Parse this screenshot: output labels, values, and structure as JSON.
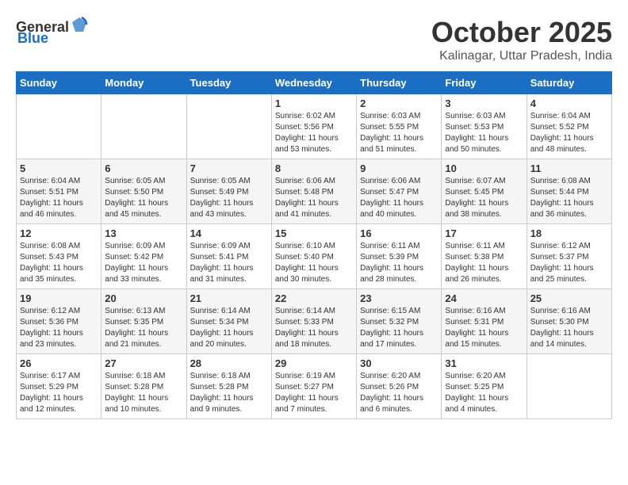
{
  "header": {
    "logo": {
      "text_general": "General",
      "text_blue": "Blue"
    },
    "month": "October 2025",
    "location": "Kalinagar, Uttar Pradesh, India"
  },
  "weekdays": [
    "Sunday",
    "Monday",
    "Tuesday",
    "Wednesday",
    "Thursday",
    "Friday",
    "Saturday"
  ],
  "weeks": [
    [
      {
        "day": "",
        "sunrise": "",
        "sunset": "",
        "daylight": ""
      },
      {
        "day": "",
        "sunrise": "",
        "sunset": "",
        "daylight": ""
      },
      {
        "day": "",
        "sunrise": "",
        "sunset": "",
        "daylight": ""
      },
      {
        "day": "1",
        "sunrise": "Sunrise: 6:02 AM",
        "sunset": "Sunset: 5:56 PM",
        "daylight": "Daylight: 11 hours and 53 minutes."
      },
      {
        "day": "2",
        "sunrise": "Sunrise: 6:03 AM",
        "sunset": "Sunset: 5:55 PM",
        "daylight": "Daylight: 11 hours and 51 minutes."
      },
      {
        "day": "3",
        "sunrise": "Sunrise: 6:03 AM",
        "sunset": "Sunset: 5:53 PM",
        "daylight": "Daylight: 11 hours and 50 minutes."
      },
      {
        "day": "4",
        "sunrise": "Sunrise: 6:04 AM",
        "sunset": "Sunset: 5:52 PM",
        "daylight": "Daylight: 11 hours and 48 minutes."
      }
    ],
    [
      {
        "day": "5",
        "sunrise": "Sunrise: 6:04 AM",
        "sunset": "Sunset: 5:51 PM",
        "daylight": "Daylight: 11 hours and 46 minutes."
      },
      {
        "day": "6",
        "sunrise": "Sunrise: 6:05 AM",
        "sunset": "Sunset: 5:50 PM",
        "daylight": "Daylight: 11 hours and 45 minutes."
      },
      {
        "day": "7",
        "sunrise": "Sunrise: 6:05 AM",
        "sunset": "Sunset: 5:49 PM",
        "daylight": "Daylight: 11 hours and 43 minutes."
      },
      {
        "day": "8",
        "sunrise": "Sunrise: 6:06 AM",
        "sunset": "Sunset: 5:48 PM",
        "daylight": "Daylight: 11 hours and 41 minutes."
      },
      {
        "day": "9",
        "sunrise": "Sunrise: 6:06 AM",
        "sunset": "Sunset: 5:47 PM",
        "daylight": "Daylight: 11 hours and 40 minutes."
      },
      {
        "day": "10",
        "sunrise": "Sunrise: 6:07 AM",
        "sunset": "Sunset: 5:45 PM",
        "daylight": "Daylight: 11 hours and 38 minutes."
      },
      {
        "day": "11",
        "sunrise": "Sunrise: 6:08 AM",
        "sunset": "Sunset: 5:44 PM",
        "daylight": "Daylight: 11 hours and 36 minutes."
      }
    ],
    [
      {
        "day": "12",
        "sunrise": "Sunrise: 6:08 AM",
        "sunset": "Sunset: 5:43 PM",
        "daylight": "Daylight: 11 hours and 35 minutes."
      },
      {
        "day": "13",
        "sunrise": "Sunrise: 6:09 AM",
        "sunset": "Sunset: 5:42 PM",
        "daylight": "Daylight: 11 hours and 33 minutes."
      },
      {
        "day": "14",
        "sunrise": "Sunrise: 6:09 AM",
        "sunset": "Sunset: 5:41 PM",
        "daylight": "Daylight: 11 hours and 31 minutes."
      },
      {
        "day": "15",
        "sunrise": "Sunrise: 6:10 AM",
        "sunset": "Sunset: 5:40 PM",
        "daylight": "Daylight: 11 hours and 30 minutes."
      },
      {
        "day": "16",
        "sunrise": "Sunrise: 6:11 AM",
        "sunset": "Sunset: 5:39 PM",
        "daylight": "Daylight: 11 hours and 28 minutes."
      },
      {
        "day": "17",
        "sunrise": "Sunrise: 6:11 AM",
        "sunset": "Sunset: 5:38 PM",
        "daylight": "Daylight: 11 hours and 26 minutes."
      },
      {
        "day": "18",
        "sunrise": "Sunrise: 6:12 AM",
        "sunset": "Sunset: 5:37 PM",
        "daylight": "Daylight: 11 hours and 25 minutes."
      }
    ],
    [
      {
        "day": "19",
        "sunrise": "Sunrise: 6:12 AM",
        "sunset": "Sunset: 5:36 PM",
        "daylight": "Daylight: 11 hours and 23 minutes."
      },
      {
        "day": "20",
        "sunrise": "Sunrise: 6:13 AM",
        "sunset": "Sunset: 5:35 PM",
        "daylight": "Daylight: 11 hours and 21 minutes."
      },
      {
        "day": "21",
        "sunrise": "Sunrise: 6:14 AM",
        "sunset": "Sunset: 5:34 PM",
        "daylight": "Daylight: 11 hours and 20 minutes."
      },
      {
        "day": "22",
        "sunrise": "Sunrise: 6:14 AM",
        "sunset": "Sunset: 5:33 PM",
        "daylight": "Daylight: 11 hours and 18 minutes."
      },
      {
        "day": "23",
        "sunrise": "Sunrise: 6:15 AM",
        "sunset": "Sunset: 5:32 PM",
        "daylight": "Daylight: 11 hours and 17 minutes."
      },
      {
        "day": "24",
        "sunrise": "Sunrise: 6:16 AM",
        "sunset": "Sunset: 5:31 PM",
        "daylight": "Daylight: 11 hours and 15 minutes."
      },
      {
        "day": "25",
        "sunrise": "Sunrise: 6:16 AM",
        "sunset": "Sunset: 5:30 PM",
        "daylight": "Daylight: 11 hours and 14 minutes."
      }
    ],
    [
      {
        "day": "26",
        "sunrise": "Sunrise: 6:17 AM",
        "sunset": "Sunset: 5:29 PM",
        "daylight": "Daylight: 11 hours and 12 minutes."
      },
      {
        "day": "27",
        "sunrise": "Sunrise: 6:18 AM",
        "sunset": "Sunset: 5:28 PM",
        "daylight": "Daylight: 11 hours and 10 minutes."
      },
      {
        "day": "28",
        "sunrise": "Sunrise: 6:18 AM",
        "sunset": "Sunset: 5:28 PM",
        "daylight": "Daylight: 11 hours and 9 minutes."
      },
      {
        "day": "29",
        "sunrise": "Sunrise: 6:19 AM",
        "sunset": "Sunset: 5:27 PM",
        "daylight": "Daylight: 11 hours and 7 minutes."
      },
      {
        "day": "30",
        "sunrise": "Sunrise: 6:20 AM",
        "sunset": "Sunset: 5:26 PM",
        "daylight": "Daylight: 11 hours and 6 minutes."
      },
      {
        "day": "31",
        "sunrise": "Sunrise: 6:20 AM",
        "sunset": "Sunset: 5:25 PM",
        "daylight": "Daylight: 11 hours and 4 minutes."
      },
      {
        "day": "",
        "sunrise": "",
        "sunset": "",
        "daylight": ""
      }
    ]
  ]
}
